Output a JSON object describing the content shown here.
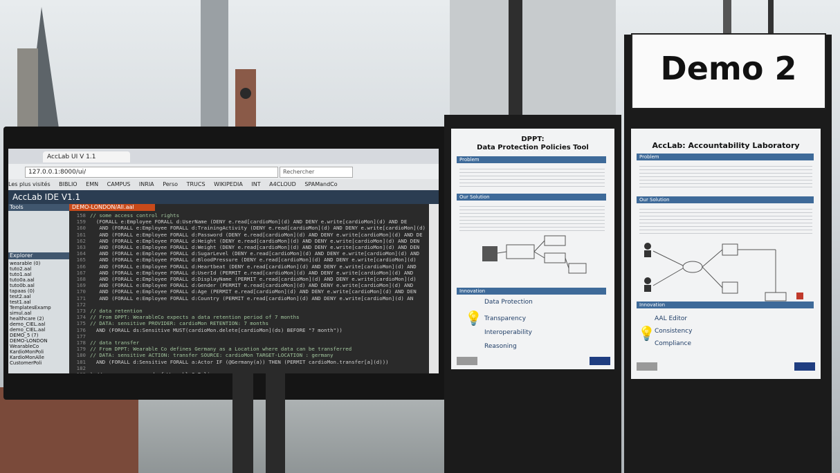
{
  "browser": {
    "tab_title": "AccLab UI V 1.1",
    "url": "127.0.0.1:8000/ui/",
    "search_placeholder": "Rechercher",
    "bookmarks": [
      "Les plus visités",
      "BIBLIO",
      "EMN",
      "CAMPUS",
      "INRIA",
      "Perso",
      "TRUCS",
      "WIKIPEDIA",
      "INT",
      "A4CLOUD",
      "SPAMandCo"
    ]
  },
  "ide": {
    "title": "AccLab IDE V1.1",
    "tools_header": "Tools",
    "explorer_header": "Explorer",
    "editor_tab": "DEMO-LONDON/All.aal",
    "explorer_items": [
      "wearable (0)",
      "tuto2.aal",
      "tuto1.aal",
      "tuto0a.aal",
      "tuto0b.aal",
      "tapaas (0)",
      "test2.aal",
      "test1.aal",
      "TemplatesExamp",
      "simul.aal",
      "healthcare (2)",
      "demo_CIEL.aal",
      "demo_CIEL.aal",
      "DEMO_5 (7)",
      "DEMO-LONDON",
      "WearableCo",
      "KardioMonPoli",
      "KardioMonAlle",
      "CustomerPoli"
    ],
    "code_lines": [
      {
        "n": "158",
        "t": "// some access control rights"
      },
      {
        "n": "159",
        "t": "  (FORALL e:Employee FORALL d:UserName (DENY e.read[cardioMon](d) AND DENY e.write[cardioMon](d) AND DE"
      },
      {
        "n": "160",
        "t": "   AND (FORALL e:Employee FORALL d:TrainingActivity (DENY e.read[cardioMon](d) AND DENY e.write[cardioMon](d)"
      },
      {
        "n": "161",
        "t": "   AND (FORALL e:Employee FORALL d:Password (DENY e.read[cardioMon](d) AND DENY e.write[cardioMon](d) AND DE"
      },
      {
        "n": "162",
        "t": "   AND (FORALL e:Employee FORALL d:Height (DENY e.read[cardioMon](d) AND DENY e.write[cardioMon](d) AND DEN"
      },
      {
        "n": "163",
        "t": "   AND (FORALL e:Employee FORALL d:Weight (DENY e.read[cardioMon](d) AND DENY e.write[cardioMon](d) AND DEN"
      },
      {
        "n": "164",
        "t": "   AND (FORALL e:Employee FORALL d:SugarLevel (DENY e.read[cardioMon](d) AND DENY e.write[cardioMon](d) AND"
      },
      {
        "n": "165",
        "t": "   AND (FORALL e:Employee FORALL d:BloodPressure (DENY e.read[cardioMon](d) AND DENY e.write[cardioMon](d)"
      },
      {
        "n": "166",
        "t": "   AND (FORALL e:Employee FORALL d:Heartbeat (DENY e.read[cardioMon](d) AND DENY e.write[cardioMon](d) AND"
      },
      {
        "n": "167",
        "t": "   AND (FORALL e:Employee FORALL d:UserId (PERMIT e.read[cardioMon](d) AND DENY e.write[cardioMon](d) AND"
      },
      {
        "n": "168",
        "t": "   AND (FORALL e:Employee FORALL d:DisplayName (PERMIT e.read[cardioMon](d) AND DENY e.write[cardioMon](d)"
      },
      {
        "n": "169",
        "t": "   AND (FORALL e:Employee FORALL d:Gender (PERMIT e.read[cardioMon](d) AND DENY e.write[cardioMon](d) AND"
      },
      {
        "n": "170",
        "t": "   AND (FORALL e:Employee FORALL d:Age (PERMIT e.read[cardioMon](d) AND DENY e.write[cardioMon](d) AND DEN"
      },
      {
        "n": "171",
        "t": "   AND (FORALL e:Employee FORALL d:Country (PERMIT e.read[cardioMon](d) AND DENY e.write[cardioMon](d) AN"
      },
      {
        "n": "172",
        "t": ""
      },
      {
        "n": "173",
        "t": "// data retention"
      },
      {
        "n": "174",
        "t": "// From DPPT: WearableCo expects a data retention period of 7 months"
      },
      {
        "n": "175",
        "t": "// DATA: sensitive PROVIDER: cardioMon RETENTION: 7 months"
      },
      {
        "n": "176",
        "t": "  AND (FORALL ds:Sensitive MUST(cardioMon.delete[cardioMon](ds) BEFORE \"7 month\"))"
      },
      {
        "n": "177",
        "t": ""
      },
      {
        "n": "178",
        "t": "// data transfer"
      },
      {
        "n": "179",
        "t": "// From DPPT: Wearable Co defines Germany as a Location where data can be transferred"
      },
      {
        "n": "180",
        "t": "// DATA: sensitive ACTION: transfer SOURCE: cardioMon TARGET-LOCATION : germany"
      },
      {
        "n": "181",
        "t": "  AND (FORALL d:Sensitive FORALL a:Actor IF (@Germany(a)) THEN (PERMIT cardioMon.transfer[a](d)))"
      },
      {
        "n": "182",
        "t": ""
      },
      {
        "n": "183",
        "t": ") // ------------ end of WearableCoPolicy"
      },
      {
        "n": "184",
        "t": ""
      }
    ]
  },
  "poster1": {
    "title_line1": "DPPT:",
    "title_line2": "Data Protection Policies Tool",
    "sections": [
      "Problem",
      "Our Solution",
      "Innovation"
    ],
    "innovation_items": [
      "Data Protection",
      "Transparency",
      "Interoperability",
      "Reasoning"
    ]
  },
  "poster2": {
    "title": "AccLab: Accountability Laboratory",
    "sections": [
      "Problem",
      "Our Solution",
      "Innovation"
    ],
    "innovation_items": [
      "AAL Editor",
      "Consistency",
      "Compliance"
    ]
  },
  "sign": {
    "text": "Demo 2"
  }
}
